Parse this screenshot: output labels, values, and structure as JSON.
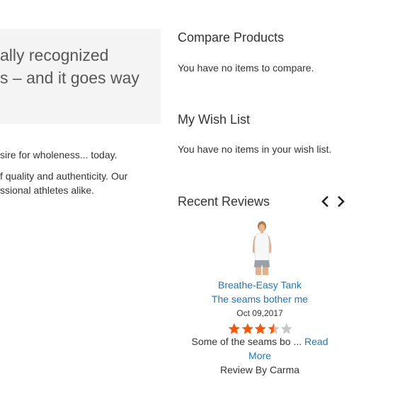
{
  "main": {
    "panel_line_1": "ally recognized",
    "panel_line_2": "s – and it goes way",
    "text_line_1": "sire for wholeness... today.",
    "text_line_2": "f quality and authenticity. Our",
    "text_line_3": "ssional athletes alike."
  },
  "compare": {
    "title": "Compare Products",
    "empty_message": "You have no items to compare."
  },
  "wishlist": {
    "title": "My Wish List",
    "empty_message": "You have no items in your wish list."
  },
  "recent_reviews": {
    "title": "Recent Reviews",
    "prev_icon": "chevron-left-icon",
    "next_icon": "chevron-right-icon",
    "review": {
      "product_name": "Breathe-Easy Tank",
      "review_title": "The seams bother me",
      "date": "Oct 09,2017",
      "rating_stars": 3.5,
      "rating_max": 5,
      "star_color": "#ff5501",
      "star_empty_color": "#c7c7c7",
      "excerpt": "Some of the seams bo ...",
      "read_more_line_1": "Read",
      "read_more_line_2": "More",
      "review_by": "Review By Carma"
    }
  }
}
